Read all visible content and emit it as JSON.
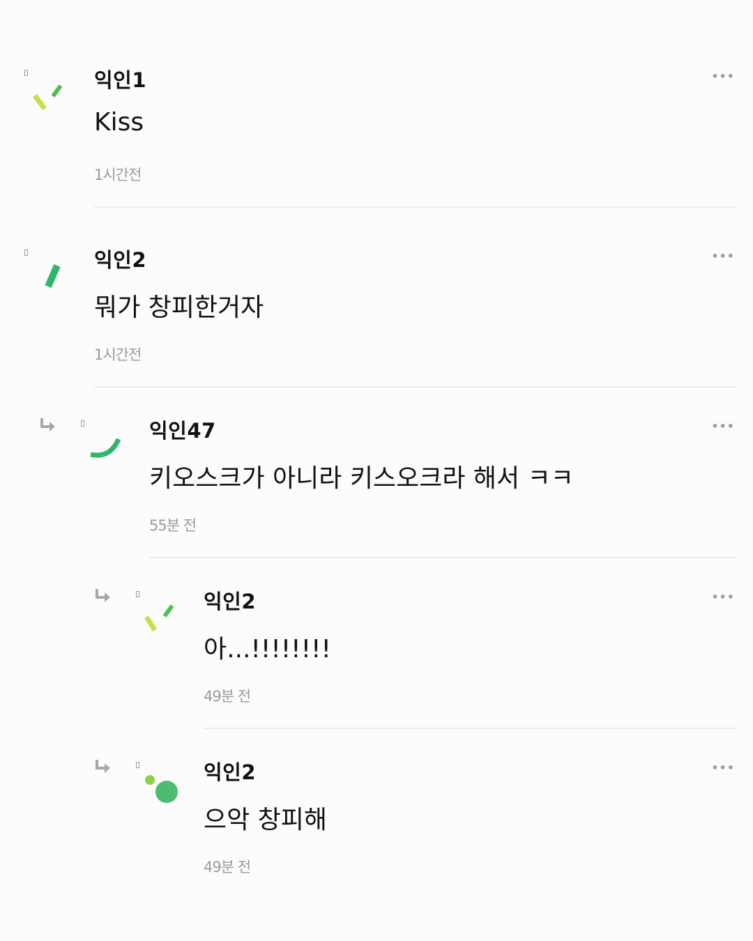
{
  "more_label": "•••",
  "comments": [
    {
      "author": "익인1",
      "content": "Kiss",
      "time": "1시간전",
      "avatar": "dashes-green-yellow-icon"
    },
    {
      "author": "익인2",
      "content": "뭐가 창피한거자",
      "time": "1시간전",
      "avatar": "slash-green-icon"
    },
    {
      "author": "익인47",
      "content": "키오스크가 아니라 키스오크라 해서 ㅋㅋ",
      "time": "55분 전",
      "avatar": "arc-green-icon",
      "reply": true
    },
    {
      "author": "익인2",
      "content": "아...!!!!!!!!",
      "time": "49분 전",
      "avatar": "dashes-green-yellow-icon",
      "reply": true
    },
    {
      "author": "익인2",
      "content": "으악 창피해",
      "time": "49분 전",
      "avatar": "dots-green-icon",
      "reply": true
    }
  ],
  "colors": {
    "brand_green": "#2db86a",
    "light_green": "#8bd14a",
    "yellow_green": "#c9dc4a",
    "muted": "#9a9a9a"
  }
}
